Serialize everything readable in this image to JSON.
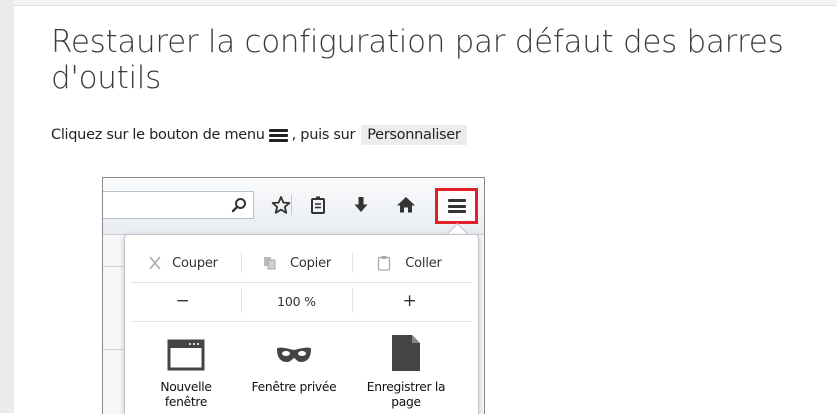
{
  "article": {
    "title": "Restaurer la configuration par défaut des barres d'outils",
    "instruction_part1": "Cliquez sur le bouton de menu",
    "instruction_part2": ", puis sur",
    "personalize_label": "Personnaliser"
  },
  "toolbar_icons": [
    "search-icon",
    "star-icon",
    "bookmarks-icon",
    "download-icon",
    "home-icon",
    "menu-icon"
  ],
  "menu_panel": {
    "edit_row": {
      "cut": "Couper",
      "copy": "Copier",
      "paste": "Coller"
    },
    "zoom_row": {
      "decrease": "−",
      "level": "100 %",
      "increase": "+"
    },
    "items": [
      {
        "label": "Nouvelle fenêtre",
        "icon": "window-icon"
      },
      {
        "label": "Fenêtre privée",
        "icon": "mask-icon"
      },
      {
        "label": "Enregistrer la page",
        "icon": "page-icon"
      }
    ]
  },
  "colors": {
    "highlight_border": "#e21f26",
    "chip_bg": "#ececec",
    "title_text": "#3a3a3a"
  }
}
